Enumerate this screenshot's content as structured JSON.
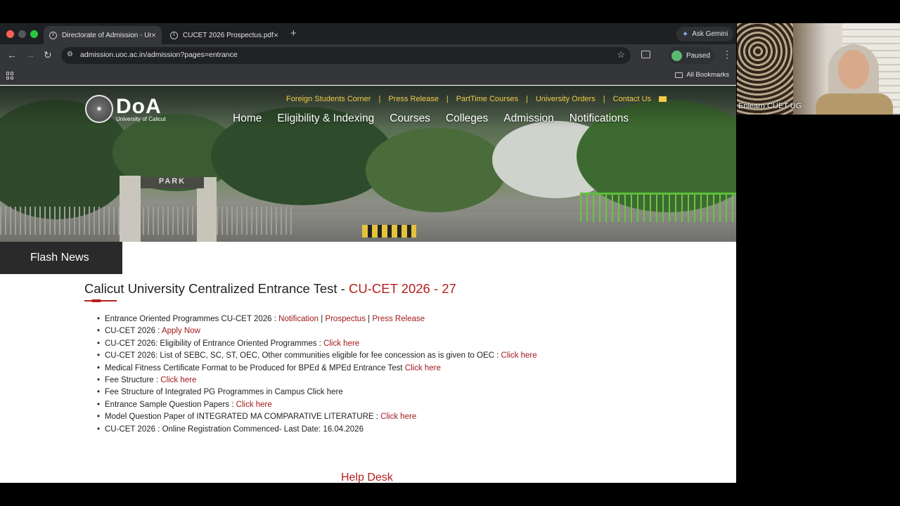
{
  "browser": {
    "tabs": [
      {
        "title": "Directorate of Admission - Ur",
        "active": true
      },
      {
        "title": "CUCET 2026 Prospectus.pdf",
        "active": false
      }
    ],
    "new_tab": "+",
    "ask_gemini": "Ask Gemini",
    "url": "admission.uoc.ac.in/admission?pages=entrance",
    "profile_status": "Paused",
    "all_bookmarks": "All Bookmarks"
  },
  "site": {
    "logo_big": "DoA",
    "logo_small": "University of Calicut",
    "top_links": [
      "Foreign Students Corner",
      "Press Release",
      "PartTime Courses",
      "University Orders",
      "Contact Us"
    ],
    "nav": [
      "Home",
      "Eligibility & Indexing",
      "Courses",
      "Colleges",
      "Admission",
      "Notifications"
    ],
    "gate_sign": "PARK",
    "flash_news": "Flash News",
    "heading_prefix": "Calicut University Centralized Entrance Test - ",
    "heading_accent": "CU-CET 2026 - 27",
    "help_desk": "Help Desk"
  },
  "items": [
    {
      "text": "Entrance Oriented Programmes CU-CET 2026 : ",
      "links": [
        "Notification",
        "Prospectus",
        "Press Release"
      ]
    },
    {
      "text": "CU-CET 2026 : ",
      "links": [
        "Apply Now"
      ]
    },
    {
      "text": "CU-CET 2026: Eligibility of Entrance Oriented Programmes : ",
      "links": [
        "Click here"
      ]
    },
    {
      "text": "CU-CET 2026: List of SEBC, SC, ST, OEC, Other communities eligible for fee concession as is given to OEC : ",
      "links": [
        "Click here"
      ]
    },
    {
      "text": "Medical Fitness Certificate Format to be Produced for BPEd & MPEd Entrance Test ",
      "links": [
        "Click here"
      ]
    },
    {
      "text": "Fee Structure : ",
      "links": [
        "Click here"
      ]
    },
    {
      "text": "Fee Structure of Integrated PG Programmes in Campus Click here",
      "links": []
    },
    {
      "text": "Entrance Sample Question Papers : ",
      "links": [
        "Click here"
      ]
    },
    {
      "text": "Model Question Paper of INTEGRATED MA COMPARATIVE LITERATURE : ",
      "links": [
        "Click here"
      ]
    },
    {
      "text": "CU-CET 2026 : Online Registration Commenced- Last Date: 16.04.2026",
      "links": []
    }
  ],
  "webcam": {
    "label": "Enlearn CUET UG"
  },
  "colors": {
    "accent": "#b3201e",
    "top_link": "#f5c94a"
  }
}
